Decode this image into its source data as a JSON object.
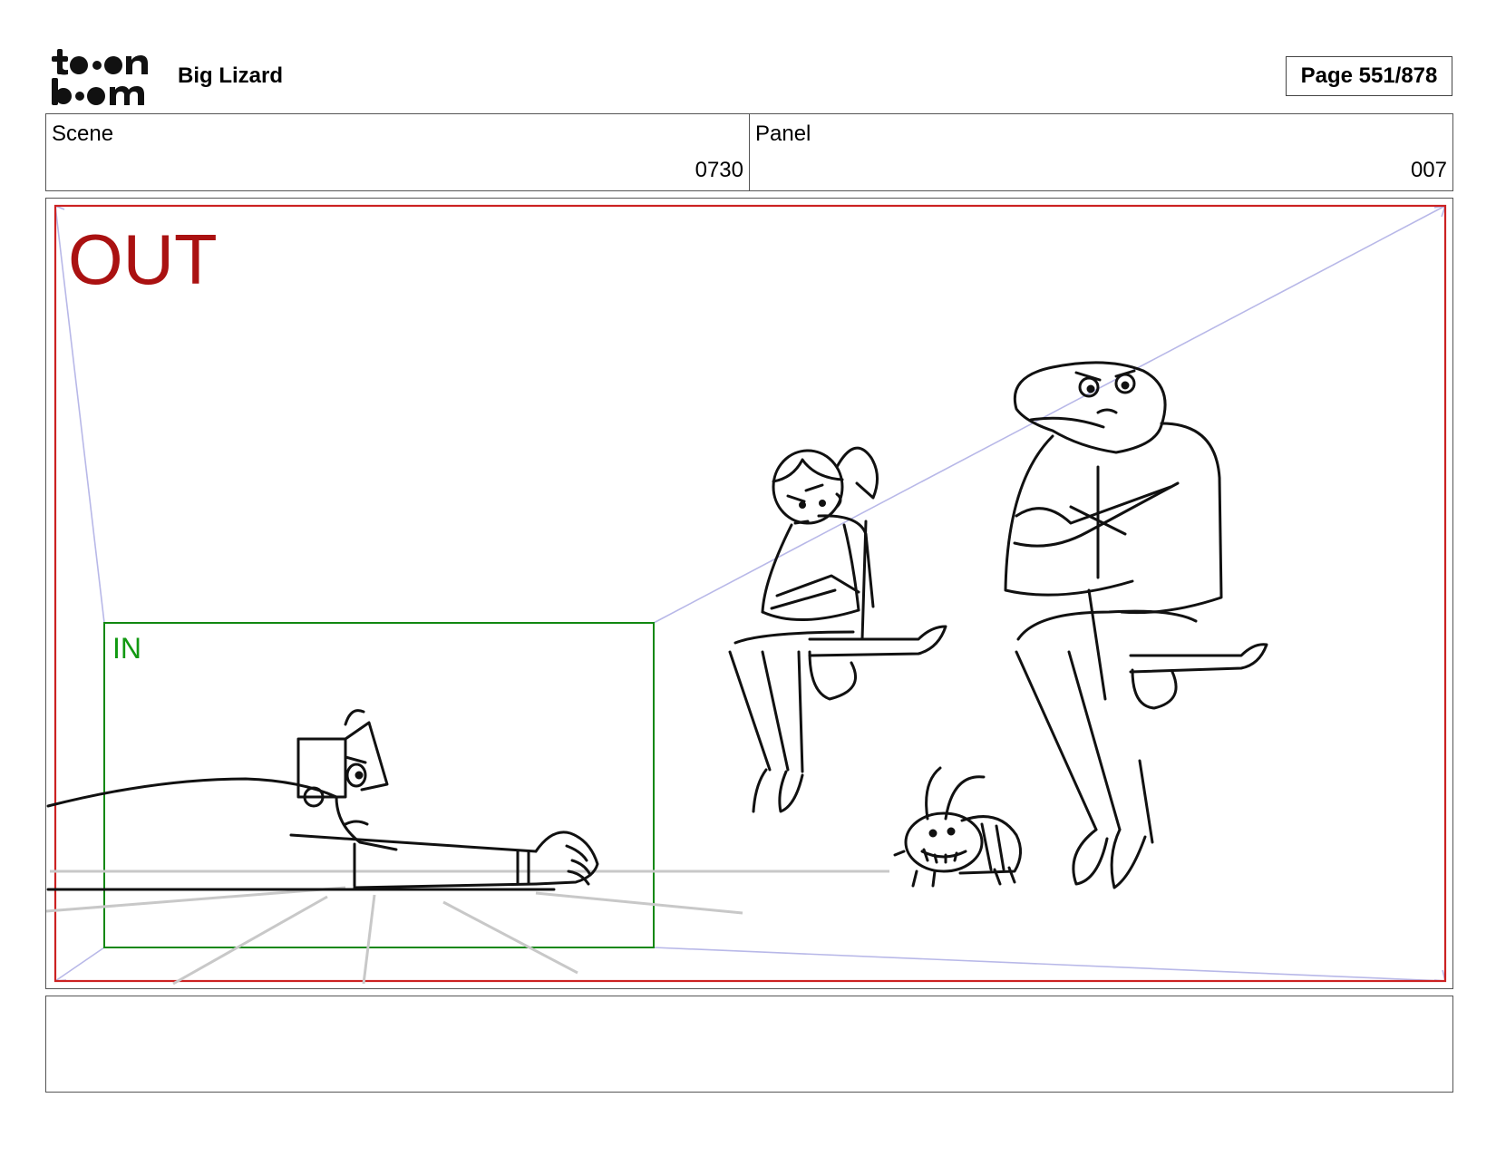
{
  "header": {
    "logo_icon": "toon-boom-logo",
    "project_title": "Big Lizard",
    "page_indicator": "Page 551/878"
  },
  "scene": {
    "label": "Scene",
    "value": "0730"
  },
  "panel": {
    "label": "Panel",
    "value": "007"
  },
  "frame": {
    "out_label": "OUT",
    "in_label": "IN",
    "out_frame_color": "#cc2222",
    "in_frame_color": "#118811",
    "perspective_line_color": "#b8b8e8"
  },
  "notes": {
    "text": ""
  }
}
